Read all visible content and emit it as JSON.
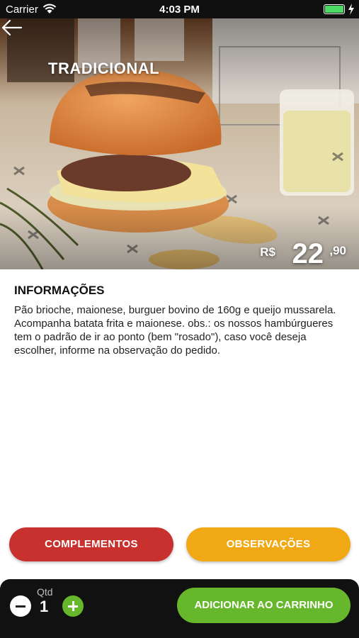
{
  "status_bar": {
    "carrier": "Carrier",
    "time": "4:03 PM",
    "battery_color": "#4cd964"
  },
  "product": {
    "title": "TRADICIONAL",
    "price_currency": "R$",
    "price_integer": "22",
    "price_cents": ",90",
    "image_icon": "burger-photo"
  },
  "info": {
    "heading": "INFORMAÇÕES",
    "description": "Pão brioche, maionese, burguer bovino de 160g e queijo mussarela. Acompanha batata frita e maionese.  obs.: os nossos hambúrgueres tem o padrão de ir ao ponto (bem \"rosado\"), caso você deseja escolher, informe na observação do pedido."
  },
  "actions": {
    "complementos_label": "COMPLEMENTOS",
    "complementos_color": "#c8312e",
    "observacoes_label": "OBSERVAÇÕES",
    "observacoes_color": "#f0a914"
  },
  "cart": {
    "qty_label": "Qtd",
    "qty_value": "1",
    "add_label": "ADICIONAR AO CARRINHO",
    "accent_color": "#66b72c"
  }
}
